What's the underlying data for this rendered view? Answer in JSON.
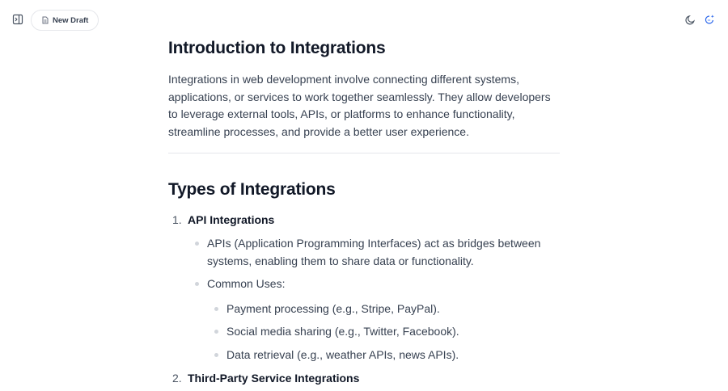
{
  "toolbar": {
    "new_draft_label": "New Draft",
    "icons": {
      "sidebar_toggle": "sidebar-toggle-icon",
      "new_draft": "document-icon",
      "theme_toggle": "moon-icon",
      "ai_assistant": "sparkle-chat-icon"
    },
    "accent_color": "#2563eb"
  },
  "document": {
    "title": "Introduction to Integrations",
    "intro": "Integrations in web development involve connecting different systems, applications, or services to work together seamlessly. They allow developers to leverage external tools, APIs, or platforms to enhance functionality, streamline processes, and provide a better user experience.",
    "section_title": "Types of Integrations",
    "list": [
      {
        "number": "1.",
        "label": "API Integrations",
        "bullets": [
          "APIs (Application Programming Interfaces) act as bridges between systems, enabling them to share data or functionality.",
          "Common Uses:"
        ],
        "sub_bullets": [
          "Payment processing (e.g., Stripe, PayPal).",
          "Social media sharing (e.g., Twitter, Facebook).",
          "Data retrieval (e.g., weather APIs, news APIs)."
        ]
      },
      {
        "number": "2.",
        "label": "Third-Party Service Integrations"
      }
    ]
  }
}
